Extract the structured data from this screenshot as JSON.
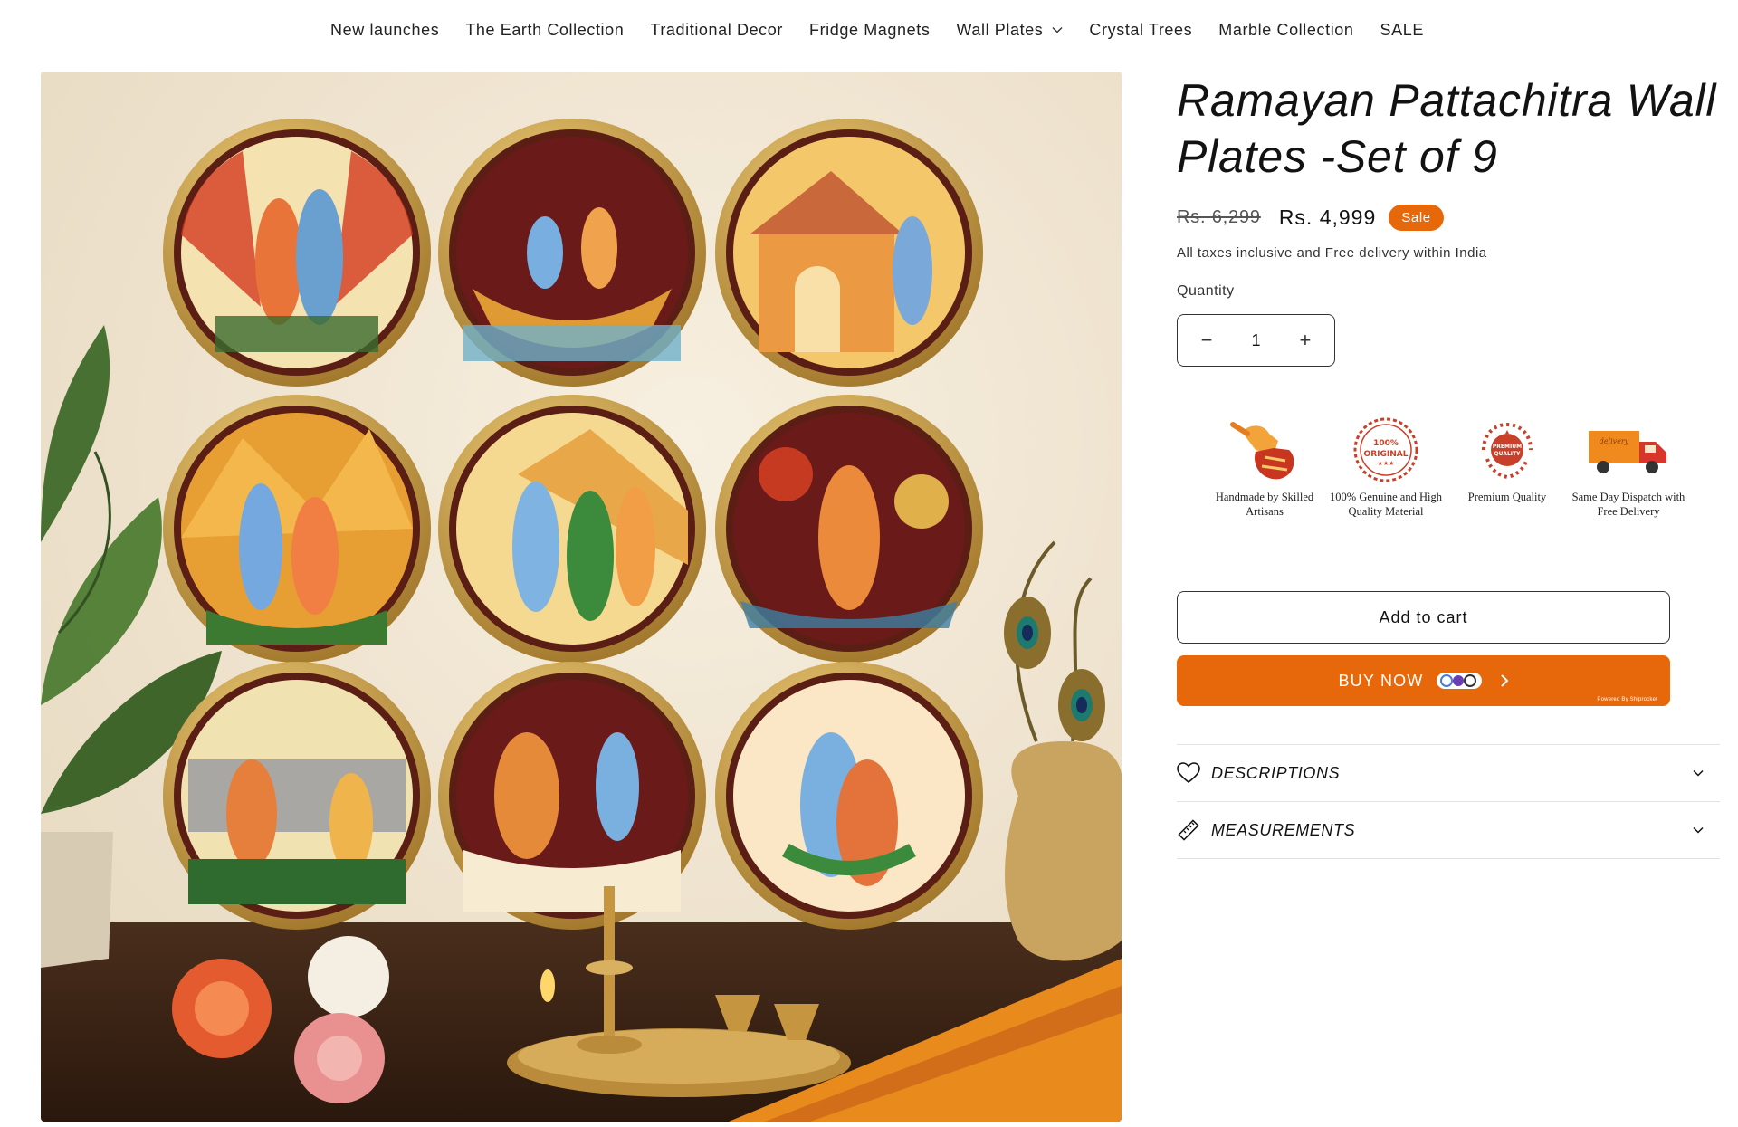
{
  "nav": {
    "items": [
      {
        "label": "New launches"
      },
      {
        "label": "The Earth Collection"
      },
      {
        "label": "Traditional Decor"
      },
      {
        "label": "Fridge Magnets"
      },
      {
        "label": "Wall Plates",
        "dropdown": true
      },
      {
        "label": "Crystal Trees"
      },
      {
        "label": "Marble Collection"
      },
      {
        "label": "SALE"
      }
    ]
  },
  "product": {
    "title": "Ramayan Pattachitra Wall Plates -Set of 9",
    "price_original": "Rs. 6,299",
    "price_sale": "Rs. 4,999",
    "sale_badge": "Sale",
    "tax_note": "All taxes inclusive and Free delivery within India",
    "quantity_label": "Quantity",
    "quantity_value": "1",
    "quantity_minus": "−",
    "quantity_plus": "+"
  },
  "badges": [
    {
      "icon": "handmade-icon",
      "text": "Handmade by Skilled Artisans"
    },
    {
      "icon": "original-seal-icon",
      "text": "100% Genuine and High Quality Material",
      "seal_text": "100% ORIGINAL"
    },
    {
      "icon": "premium-quality-icon",
      "text": "Premium Quality",
      "seal_text": "PREMIUM QUALITY"
    },
    {
      "icon": "delivery-truck-icon",
      "text": "Same Day Dispatch with Free Delivery",
      "seal_text": "delivery"
    }
  ],
  "buttons": {
    "add_to_cart": "Add to cart",
    "buy_now": "BUY NOW",
    "powered_by": "Powered By Shiprocket"
  },
  "accordion": [
    {
      "icon": "heart-icon",
      "label": "DESCRIPTIONS"
    },
    {
      "icon": "ruler-icon",
      "label": "MEASUREMENTS"
    }
  ],
  "colors": {
    "accent": "#e7680b",
    "text": "#121212",
    "border": "#e2e2e2"
  }
}
